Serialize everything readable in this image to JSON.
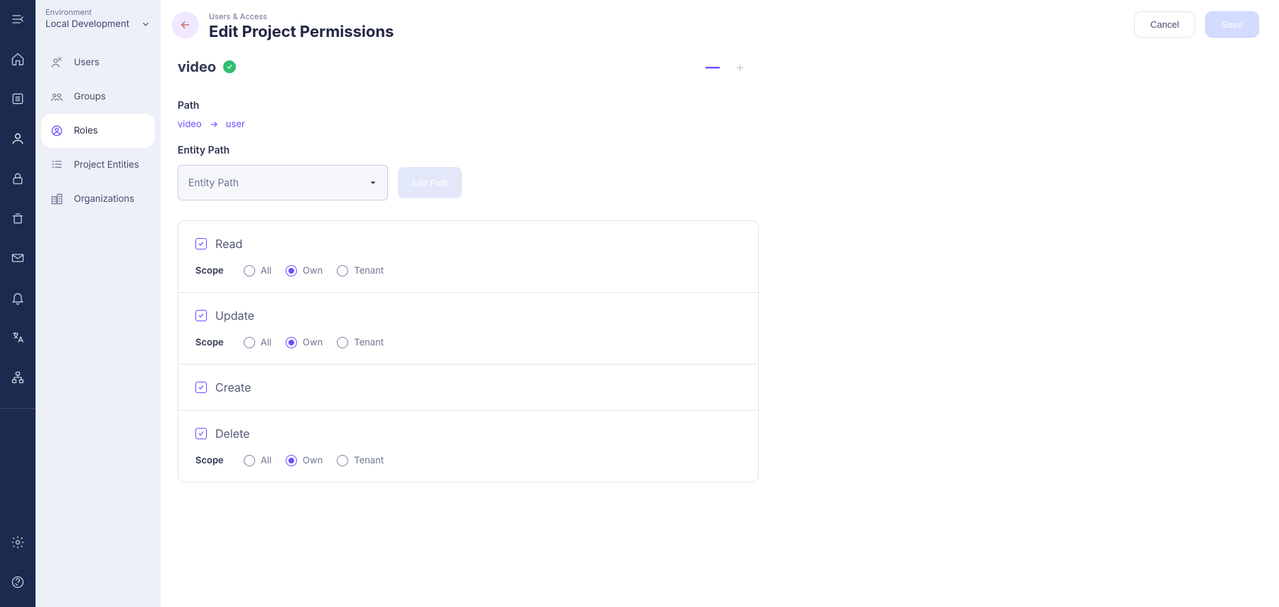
{
  "rail": {
    "items": [
      "menu",
      "home",
      "list",
      "user",
      "lock",
      "archive",
      "mail",
      "bell",
      "translate",
      "sitemap"
    ],
    "bottom": [
      "gear",
      "support"
    ]
  },
  "env": {
    "label": "Environment",
    "value": "Local Development"
  },
  "sidebar": {
    "items": [
      {
        "label": "Users"
      },
      {
        "label": "Groups"
      },
      {
        "label": "Roles"
      },
      {
        "label": "Project Entities"
      },
      {
        "label": "Organizations"
      }
    ]
  },
  "header": {
    "crumb": "Users & Access",
    "title": "Edit Project Permissions",
    "cancel": "Cancel",
    "save": "Save"
  },
  "entity": {
    "name": "video"
  },
  "path": {
    "label": "Path",
    "segments": [
      "video",
      "user"
    ],
    "entity_path_label": "Entity Path",
    "select_placeholder": "Entity Path",
    "add_button": "Add Path"
  },
  "scope": {
    "label": "Scope",
    "options": [
      "All",
      "Own",
      "Tenant"
    ]
  },
  "permissions": [
    {
      "name": "Read",
      "checked": true,
      "has_scope": true,
      "selected": "Own"
    },
    {
      "name": "Update",
      "checked": true,
      "has_scope": true,
      "selected": "Own"
    },
    {
      "name": "Create",
      "checked": true,
      "has_scope": false
    },
    {
      "name": "Delete",
      "checked": true,
      "has_scope": true,
      "selected": "Own"
    }
  ]
}
